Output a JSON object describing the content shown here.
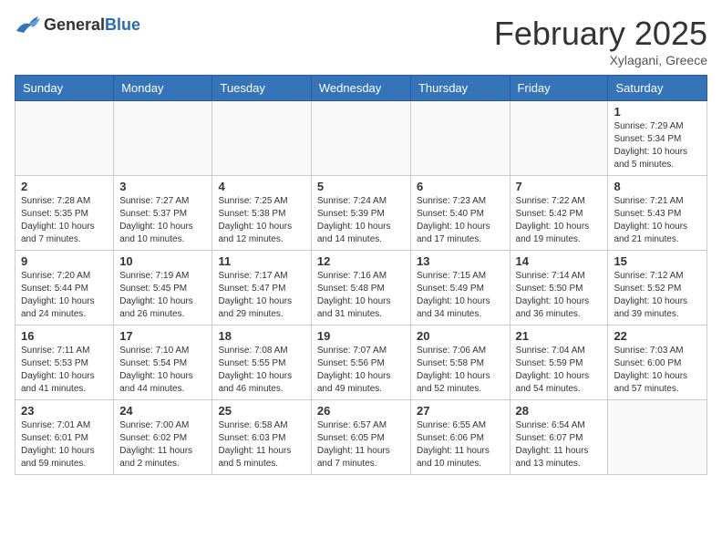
{
  "header": {
    "logo_general": "General",
    "logo_blue": "Blue",
    "title": "February 2025",
    "location": "Xylagani, Greece"
  },
  "days_of_week": [
    "Sunday",
    "Monday",
    "Tuesday",
    "Wednesday",
    "Thursday",
    "Friday",
    "Saturday"
  ],
  "weeks": [
    [
      {
        "day": "",
        "info": ""
      },
      {
        "day": "",
        "info": ""
      },
      {
        "day": "",
        "info": ""
      },
      {
        "day": "",
        "info": ""
      },
      {
        "day": "",
        "info": ""
      },
      {
        "day": "",
        "info": ""
      },
      {
        "day": "1",
        "info": "Sunrise: 7:29 AM\nSunset: 5:34 PM\nDaylight: 10 hours\nand 5 minutes."
      }
    ],
    [
      {
        "day": "2",
        "info": "Sunrise: 7:28 AM\nSunset: 5:35 PM\nDaylight: 10 hours\nand 7 minutes."
      },
      {
        "day": "3",
        "info": "Sunrise: 7:27 AM\nSunset: 5:37 PM\nDaylight: 10 hours\nand 10 minutes."
      },
      {
        "day": "4",
        "info": "Sunrise: 7:25 AM\nSunset: 5:38 PM\nDaylight: 10 hours\nand 12 minutes."
      },
      {
        "day": "5",
        "info": "Sunrise: 7:24 AM\nSunset: 5:39 PM\nDaylight: 10 hours\nand 14 minutes."
      },
      {
        "day": "6",
        "info": "Sunrise: 7:23 AM\nSunset: 5:40 PM\nDaylight: 10 hours\nand 17 minutes."
      },
      {
        "day": "7",
        "info": "Sunrise: 7:22 AM\nSunset: 5:42 PM\nDaylight: 10 hours\nand 19 minutes."
      },
      {
        "day": "8",
        "info": "Sunrise: 7:21 AM\nSunset: 5:43 PM\nDaylight: 10 hours\nand 21 minutes."
      }
    ],
    [
      {
        "day": "9",
        "info": "Sunrise: 7:20 AM\nSunset: 5:44 PM\nDaylight: 10 hours\nand 24 minutes."
      },
      {
        "day": "10",
        "info": "Sunrise: 7:19 AM\nSunset: 5:45 PM\nDaylight: 10 hours\nand 26 minutes."
      },
      {
        "day": "11",
        "info": "Sunrise: 7:17 AM\nSunset: 5:47 PM\nDaylight: 10 hours\nand 29 minutes."
      },
      {
        "day": "12",
        "info": "Sunrise: 7:16 AM\nSunset: 5:48 PM\nDaylight: 10 hours\nand 31 minutes."
      },
      {
        "day": "13",
        "info": "Sunrise: 7:15 AM\nSunset: 5:49 PM\nDaylight: 10 hours\nand 34 minutes."
      },
      {
        "day": "14",
        "info": "Sunrise: 7:14 AM\nSunset: 5:50 PM\nDaylight: 10 hours\nand 36 minutes."
      },
      {
        "day": "15",
        "info": "Sunrise: 7:12 AM\nSunset: 5:52 PM\nDaylight: 10 hours\nand 39 minutes."
      }
    ],
    [
      {
        "day": "16",
        "info": "Sunrise: 7:11 AM\nSunset: 5:53 PM\nDaylight: 10 hours\nand 41 minutes."
      },
      {
        "day": "17",
        "info": "Sunrise: 7:10 AM\nSunset: 5:54 PM\nDaylight: 10 hours\nand 44 minutes."
      },
      {
        "day": "18",
        "info": "Sunrise: 7:08 AM\nSunset: 5:55 PM\nDaylight: 10 hours\nand 46 minutes."
      },
      {
        "day": "19",
        "info": "Sunrise: 7:07 AM\nSunset: 5:56 PM\nDaylight: 10 hours\nand 49 minutes."
      },
      {
        "day": "20",
        "info": "Sunrise: 7:06 AM\nSunset: 5:58 PM\nDaylight: 10 hours\nand 52 minutes."
      },
      {
        "day": "21",
        "info": "Sunrise: 7:04 AM\nSunset: 5:59 PM\nDaylight: 10 hours\nand 54 minutes."
      },
      {
        "day": "22",
        "info": "Sunrise: 7:03 AM\nSunset: 6:00 PM\nDaylight: 10 hours\nand 57 minutes."
      }
    ],
    [
      {
        "day": "23",
        "info": "Sunrise: 7:01 AM\nSunset: 6:01 PM\nDaylight: 10 hours\nand 59 minutes."
      },
      {
        "day": "24",
        "info": "Sunrise: 7:00 AM\nSunset: 6:02 PM\nDaylight: 11 hours\nand 2 minutes."
      },
      {
        "day": "25",
        "info": "Sunrise: 6:58 AM\nSunset: 6:03 PM\nDaylight: 11 hours\nand 5 minutes."
      },
      {
        "day": "26",
        "info": "Sunrise: 6:57 AM\nSunset: 6:05 PM\nDaylight: 11 hours\nand 7 minutes."
      },
      {
        "day": "27",
        "info": "Sunrise: 6:55 AM\nSunset: 6:06 PM\nDaylight: 11 hours\nand 10 minutes."
      },
      {
        "day": "28",
        "info": "Sunrise: 6:54 AM\nSunset: 6:07 PM\nDaylight: 11 hours\nand 13 minutes."
      },
      {
        "day": "",
        "info": ""
      }
    ]
  ]
}
